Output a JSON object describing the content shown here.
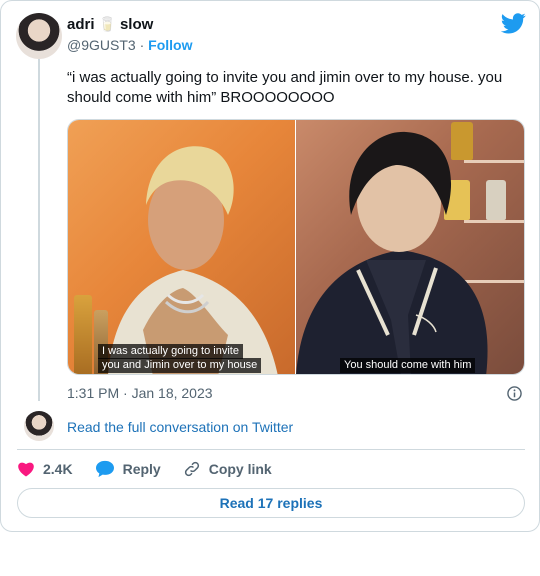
{
  "author": {
    "display_name": "adri",
    "status_emoji": "🥛",
    "status_text": "slow",
    "handle": "@9GUST3",
    "separator": "·",
    "follow_label": "Follow"
  },
  "tweet": {
    "text": "“i was actually going to invite you and jimin over to my house. you should come with him” BROOOOOOOO",
    "time": "1:31 PM · Jan 18, 2023"
  },
  "media": {
    "left_caption_line1": "I was actually going to invite",
    "left_caption_line2": "you and Jimin over to my house",
    "right_caption": "You should come with him"
  },
  "read_conversation_label": "Read the full conversation on Twitter",
  "actions": {
    "like_count": "2.4K",
    "reply_label": "Reply",
    "copy_link_label": "Copy link"
  },
  "read_replies_label": "Read 17 replies",
  "colors": {
    "accent": "#1d9bf0",
    "like": "#f91880",
    "link": "#1d72b8"
  }
}
